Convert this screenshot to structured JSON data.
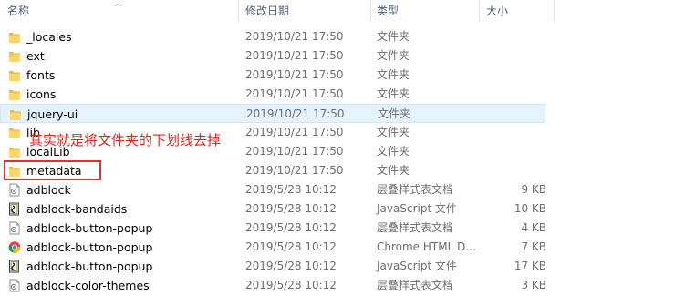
{
  "header": {
    "name": "名称",
    "date_modified": "修改日期",
    "type": "类型",
    "size": "大小"
  },
  "annotation": "其实就是将文件夹的下划线去掉",
  "files": [
    {
      "name": "_locales",
      "date": "2019/10/21 17:50",
      "type": "文件夹",
      "size": "",
      "icon": "folder-icon"
    },
    {
      "name": "ext",
      "date": "2019/10/21 17:50",
      "type": "文件夹",
      "size": "",
      "icon": "folder-icon"
    },
    {
      "name": "fonts",
      "date": "2019/10/21 17:50",
      "type": "文件夹",
      "size": "",
      "icon": "folder-icon"
    },
    {
      "name": "icons",
      "date": "2019/10/21 17:50",
      "type": "文件夹",
      "size": "",
      "icon": "folder-icon"
    },
    {
      "name": "jquery-ui",
      "date": "2019/10/21 17:50",
      "type": "文件夹",
      "size": "",
      "icon": "folder-icon"
    },
    {
      "name": "lib",
      "date": "2019/10/21 17:50",
      "type": "文件夹",
      "size": "",
      "icon": "folder-icon"
    },
    {
      "name": "localLib",
      "date": "2019/10/21 17:50",
      "type": "文件夹",
      "size": "",
      "icon": "folder-icon"
    },
    {
      "name": "metadata",
      "date": "2019/10/21 17:50",
      "type": "文件夹",
      "size": "",
      "icon": "folder-icon"
    },
    {
      "name": "adblock",
      "date": "2019/5/28 10:12",
      "type": "层叠样式表文档",
      "size": "9 KB",
      "icon": "css-file-icon"
    },
    {
      "name": "adblock-bandaids",
      "date": "2019/5/28 10:12",
      "type": "JavaScript 文件",
      "size": "10 KB",
      "icon": "js-file-icon"
    },
    {
      "name": "adblock-button-popup",
      "date": "2019/5/28 10:12",
      "type": "层叠样式表文档",
      "size": "4 KB",
      "icon": "css-file-icon"
    },
    {
      "name": "adblock-button-popup",
      "date": "2019/5/28 10:12",
      "type": "Chrome HTML D...",
      "size": "7 KB",
      "icon": "chrome-html-icon"
    },
    {
      "name": "adblock-button-popup",
      "date": "2019/5/28 10:12",
      "type": "JavaScript 文件",
      "size": "17 KB",
      "icon": "js-file-icon"
    },
    {
      "name": "adblock-color-themes",
      "date": "2019/5/28 10:12",
      "type": "层叠样式表文档",
      "size": "3 KB",
      "icon": "css-file-icon"
    }
  ]
}
